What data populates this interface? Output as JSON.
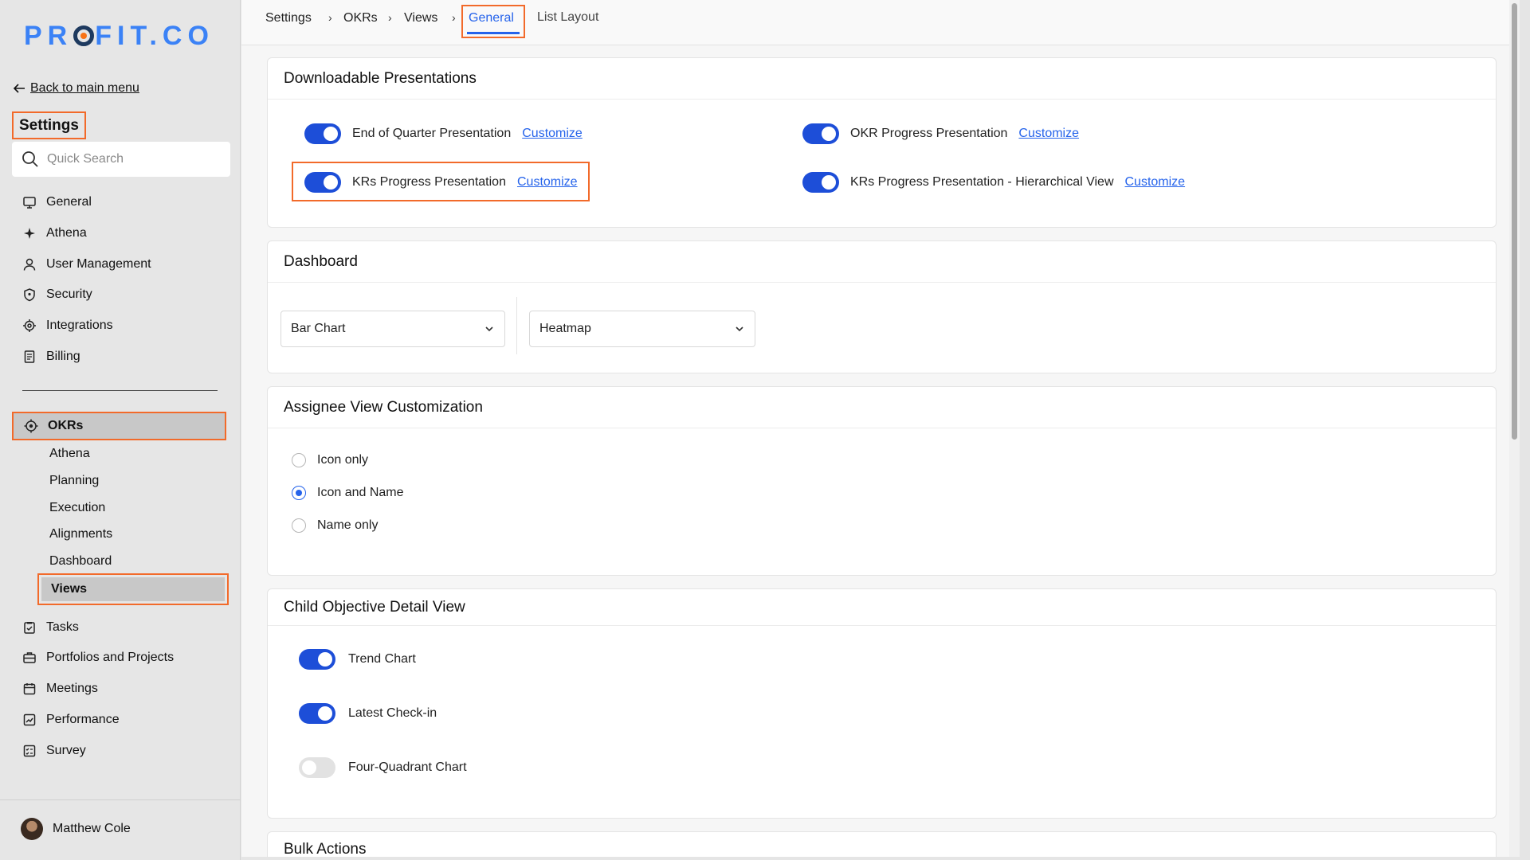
{
  "brand": {
    "logo_left": "PR",
    "logo_right": "FIT.CO"
  },
  "sidebar": {
    "back_label": "Back to main menu",
    "title": "Settings",
    "search_placeholder": "Quick Search",
    "items": [
      {
        "label": "General",
        "icon": "monitor-icon"
      },
      {
        "label": "Athena",
        "icon": "sparkle-icon"
      },
      {
        "label": "User Management",
        "icon": "user-icon"
      },
      {
        "label": "Security",
        "icon": "shield-icon"
      },
      {
        "label": "Integrations",
        "icon": "gear-icon"
      },
      {
        "label": "Billing",
        "icon": "receipt-icon"
      }
    ],
    "okrs_label": "OKRs",
    "okrs_sub": [
      "Athena",
      "Planning",
      "Execution",
      "Alignments",
      "Dashboard",
      "Views"
    ],
    "lower_items": [
      {
        "label": "Tasks",
        "icon": "clipboard-check-icon"
      },
      {
        "label": "Portfolios and Projects",
        "icon": "briefcase-icon"
      },
      {
        "label": "Meetings",
        "icon": "calendar-icon"
      },
      {
        "label": "Performance",
        "icon": "chart-line-icon"
      },
      {
        "label": "Survey",
        "icon": "checklist-icon"
      }
    ],
    "user_name": "Matthew Cole"
  },
  "breadcrumb": {
    "items": [
      "Settings",
      "OKRs",
      "Views"
    ],
    "separator": "›",
    "active_tab": "General",
    "other_tab": "List Layout"
  },
  "presentations": {
    "title": "Downloadable Presentations",
    "items": [
      {
        "label": "End of Quarter Presentation",
        "action": "Customize",
        "enabled": true
      },
      {
        "label": "OKR Progress Presentation",
        "action": "Customize",
        "enabled": true
      },
      {
        "label": "KRs Progress Presentation",
        "action": "Customize",
        "enabled": true
      },
      {
        "label": "KRs Progress Presentation - Hierarchical View",
        "action": "Customize",
        "enabled": true
      }
    ]
  },
  "dashboard": {
    "title": "Dashboard",
    "select1_value": "Bar Chart",
    "select2_value": "Heatmap"
  },
  "assignee": {
    "title": "Assignee View Customization",
    "options": [
      "Icon only",
      "Icon and Name",
      "Name only"
    ],
    "selected": "Icon and Name"
  },
  "child_objective": {
    "title": "Child Objective Detail View",
    "items": [
      {
        "label": "Trend Chart",
        "enabled": true
      },
      {
        "label": "Latest Check-in",
        "enabled": true
      },
      {
        "label": "Four-Quadrant Chart",
        "enabled": false
      }
    ]
  },
  "bulk": {
    "title": "Bulk Actions"
  },
  "colors": {
    "accent": "#1d4ed8",
    "highlight": "#f26a2a",
    "link": "#2563eb"
  }
}
